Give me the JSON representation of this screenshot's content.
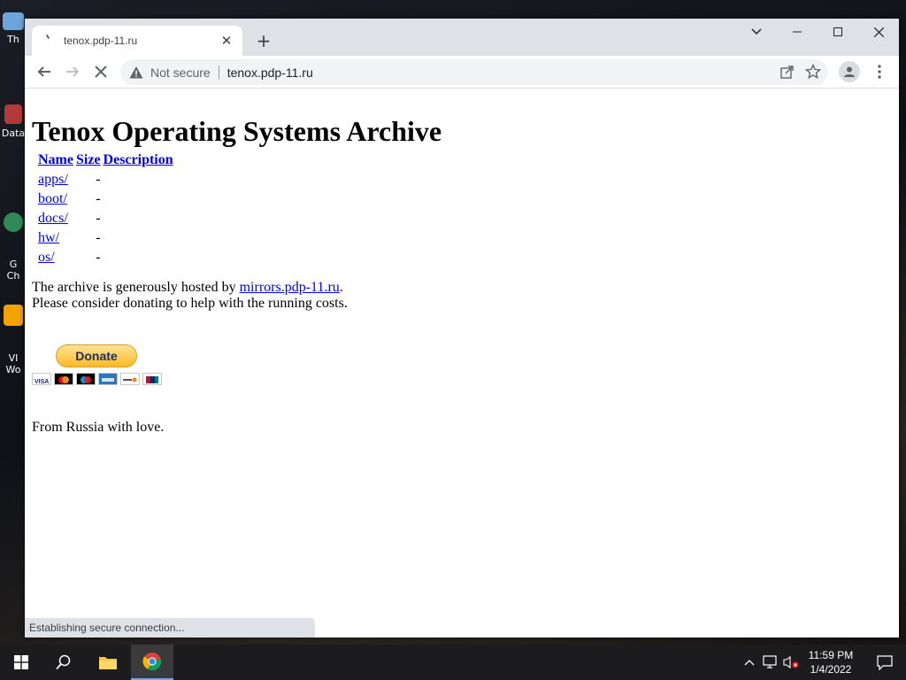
{
  "desktop": {
    "icons": [
      {
        "label": "Th"
      },
      {
        "label": "Data"
      },
      {
        "label": "G\nCh"
      },
      {
        "label": "VI\nWo"
      }
    ]
  },
  "browser": {
    "tab": {
      "title": "tenox.pdp-11.ru"
    },
    "address": {
      "security_label": "Not secure",
      "url": "tenox.pdp-11.ru"
    },
    "status_text": "Establishing secure connection..."
  },
  "page": {
    "title": "Tenox Operating Systems Archive",
    "table": {
      "headers": {
        "name": "Name",
        "size": "Size",
        "description": "Description"
      },
      "rows": [
        {
          "name": "apps/",
          "size": "-"
        },
        {
          "name": "boot/",
          "size": "-"
        },
        {
          "name": "docs/",
          "size": "-"
        },
        {
          "name": "hw/",
          "size": "-"
        },
        {
          "name": "os/",
          "size": "-"
        }
      ]
    },
    "hosted_prefix": "The archive is generously hosted by ",
    "hosted_link": "mirrors.pdp-11.ru",
    "hosted_suffix": ".",
    "donate_note": "Please consider donating to help with the running costs.",
    "donate_label": "Donate",
    "card_icons": [
      "visa-icon",
      "mastercard-icon",
      "maestro-icon",
      "amex-icon",
      "discover-icon",
      "unionpay-icon"
    ],
    "footer": "From Russia with love."
  },
  "taskbar": {
    "time": "11:59 PM",
    "date": "1/4/2022"
  },
  "colors": {
    "link": "#0000ee",
    "donate_gold": "#ffc439",
    "taskbar": "#1c1c1e"
  }
}
